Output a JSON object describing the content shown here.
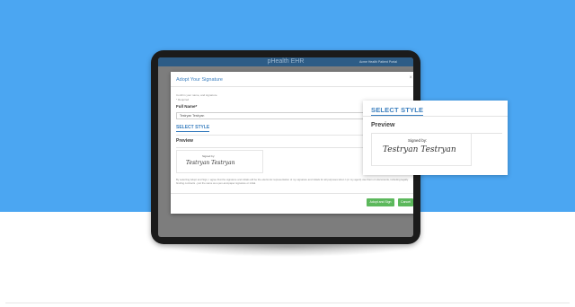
{
  "app": {
    "title": "pHealth EHR",
    "header_right": "Acme Health Patient Portal"
  },
  "modal": {
    "title": "Adopt Your Signature",
    "close_glyph": "×",
    "confirm_text": "Confirm your name, and signature.",
    "required_text": "* Required",
    "full_name_label": "Full Name*",
    "full_name_value": "Testryan Testryan",
    "select_style_label": "SELECT STYLE",
    "preview_label": "Preview",
    "signed_by_label": "Signed by:",
    "signature_text": "Testryan Testryan",
    "disclaimer": "By selecting Adopt and Sign, I agree that the signature and initials will be the electronic representation of my signature and initials for all purposes when I (or my agent) use them on documents, including legally binding contracts - just the same as a pen-and-paper signature or initial.",
    "adopt_button": "Adopt and Sign",
    "cancel_button": "Cancel"
  },
  "zoom": {
    "select_style_label": "SELECT STYLE",
    "preview_label": "Preview",
    "signed_by_label": "Signed by:",
    "signature_text": "Testryan Testryan"
  },
  "colors": {
    "hero_background": "#4ba6f2",
    "accent_blue": "#3b7fbf",
    "button_green": "#5cb85c",
    "app_header": "#2d5c86"
  }
}
